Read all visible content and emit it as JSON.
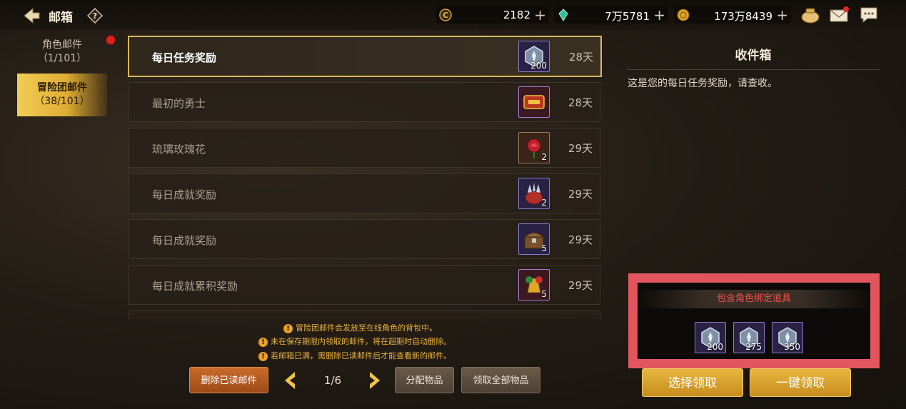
{
  "header": {
    "title": "邮箱",
    "resources": [
      {
        "icon": "gold-coin-c-icon",
        "value": "2182",
        "plus": "+"
      },
      {
        "icon": "green-crystal-icon",
        "value": "7万5781",
        "plus": "+"
      },
      {
        "icon": "gold-coin-icon",
        "value": "173万8439",
        "plus": "+"
      }
    ]
  },
  "sidebar": {
    "tabs": [
      {
        "label": "角色邮件",
        "count": "（1/101）"
      },
      {
        "label": "冒险团邮件",
        "count": "（38/101）"
      }
    ]
  },
  "mails": [
    {
      "subject": "每日任务奖励",
      "item_icon": "blue-crystal-icon",
      "qty": "200",
      "days": "28天"
    },
    {
      "subject": "最初的勇士",
      "item_icon": "zuichu-badge-icon",
      "qty": "",
      "days": "28天"
    },
    {
      "subject": "琉璃玫瑰花",
      "item_icon": "rose-icon",
      "qty": "2",
      "days": "29天"
    },
    {
      "subject": "每日成就奖励",
      "item_icon": "spiked-bag-icon",
      "qty": "2",
      "days": "29天"
    },
    {
      "subject": "每日成就奖励",
      "item_icon": "treasure-chest-icon",
      "qty": "5",
      "days": "29天"
    },
    {
      "subject": "每日成就累积奖励",
      "item_icon": "gold-bell-icon",
      "qty": "5",
      "days": "29天"
    }
  ],
  "notices": [
    "冒险团邮件会发放至在线角色的背包中。",
    "未在保存期限内领取的邮件，将在超期时自动删除。",
    "若邮箱已满，需删除已读邮件后才能查看新的邮件。"
  ],
  "footer": {
    "delete_read": "删除已读邮件",
    "page": "1/6",
    "distribute": "分配物品",
    "claim_all_items": "领取全部物品"
  },
  "detail": {
    "title": "收件箱",
    "body": "这是您的每日任务奖励，请查收。",
    "bound_header": "包含角色绑定道具",
    "rewards": [
      {
        "icon": "blue-crystal-icon",
        "qty": "200"
      },
      {
        "icon": "blue-crystal-icon",
        "qty": "275"
      },
      {
        "icon": "blue-crystal-icon",
        "qty": "350"
      }
    ],
    "select_claim": "选择领取",
    "one_click_claim": "一键领取"
  },
  "colors": {
    "accent_gold": "#e0ad33",
    "highlight_border": "#e2555e",
    "warning": "#e8b13c"
  }
}
